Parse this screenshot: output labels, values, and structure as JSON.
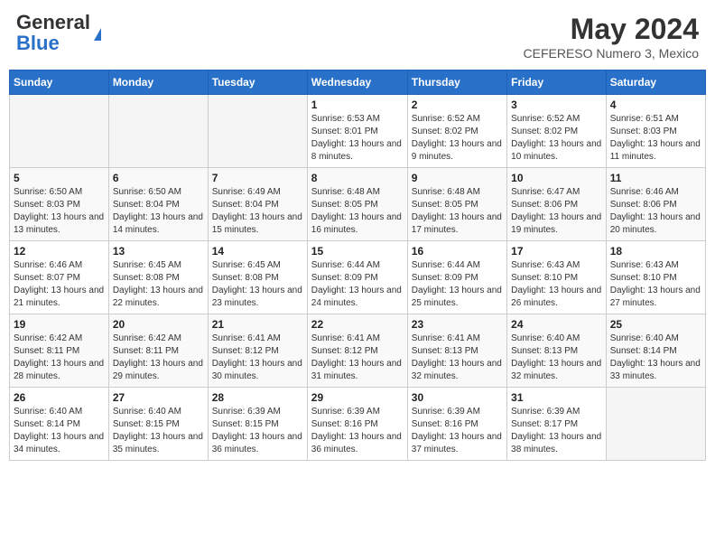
{
  "header": {
    "logo_general": "General",
    "logo_blue": "Blue",
    "title": "May 2024",
    "subtitle": "CEFERESO Numero 3, Mexico"
  },
  "days_of_week": [
    "Sunday",
    "Monday",
    "Tuesday",
    "Wednesday",
    "Thursday",
    "Friday",
    "Saturday"
  ],
  "weeks": [
    [
      {
        "day": "",
        "info": ""
      },
      {
        "day": "",
        "info": ""
      },
      {
        "day": "",
        "info": ""
      },
      {
        "day": "1",
        "info": "Sunrise: 6:53 AM\nSunset: 8:01 PM\nDaylight: 13 hours and 8 minutes."
      },
      {
        "day": "2",
        "info": "Sunrise: 6:52 AM\nSunset: 8:02 PM\nDaylight: 13 hours and 9 minutes."
      },
      {
        "day": "3",
        "info": "Sunrise: 6:52 AM\nSunset: 8:02 PM\nDaylight: 13 hours and 10 minutes."
      },
      {
        "day": "4",
        "info": "Sunrise: 6:51 AM\nSunset: 8:03 PM\nDaylight: 13 hours and 11 minutes."
      }
    ],
    [
      {
        "day": "5",
        "info": "Sunrise: 6:50 AM\nSunset: 8:03 PM\nDaylight: 13 hours and 13 minutes."
      },
      {
        "day": "6",
        "info": "Sunrise: 6:50 AM\nSunset: 8:04 PM\nDaylight: 13 hours and 14 minutes."
      },
      {
        "day": "7",
        "info": "Sunrise: 6:49 AM\nSunset: 8:04 PM\nDaylight: 13 hours and 15 minutes."
      },
      {
        "day": "8",
        "info": "Sunrise: 6:48 AM\nSunset: 8:05 PM\nDaylight: 13 hours and 16 minutes."
      },
      {
        "day": "9",
        "info": "Sunrise: 6:48 AM\nSunset: 8:05 PM\nDaylight: 13 hours and 17 minutes."
      },
      {
        "day": "10",
        "info": "Sunrise: 6:47 AM\nSunset: 8:06 PM\nDaylight: 13 hours and 19 minutes."
      },
      {
        "day": "11",
        "info": "Sunrise: 6:46 AM\nSunset: 8:06 PM\nDaylight: 13 hours and 20 minutes."
      }
    ],
    [
      {
        "day": "12",
        "info": "Sunrise: 6:46 AM\nSunset: 8:07 PM\nDaylight: 13 hours and 21 minutes."
      },
      {
        "day": "13",
        "info": "Sunrise: 6:45 AM\nSunset: 8:08 PM\nDaylight: 13 hours and 22 minutes."
      },
      {
        "day": "14",
        "info": "Sunrise: 6:45 AM\nSunset: 8:08 PM\nDaylight: 13 hours and 23 minutes."
      },
      {
        "day": "15",
        "info": "Sunrise: 6:44 AM\nSunset: 8:09 PM\nDaylight: 13 hours and 24 minutes."
      },
      {
        "day": "16",
        "info": "Sunrise: 6:44 AM\nSunset: 8:09 PM\nDaylight: 13 hours and 25 minutes."
      },
      {
        "day": "17",
        "info": "Sunrise: 6:43 AM\nSunset: 8:10 PM\nDaylight: 13 hours and 26 minutes."
      },
      {
        "day": "18",
        "info": "Sunrise: 6:43 AM\nSunset: 8:10 PM\nDaylight: 13 hours and 27 minutes."
      }
    ],
    [
      {
        "day": "19",
        "info": "Sunrise: 6:42 AM\nSunset: 8:11 PM\nDaylight: 13 hours and 28 minutes."
      },
      {
        "day": "20",
        "info": "Sunrise: 6:42 AM\nSunset: 8:11 PM\nDaylight: 13 hours and 29 minutes."
      },
      {
        "day": "21",
        "info": "Sunrise: 6:41 AM\nSunset: 8:12 PM\nDaylight: 13 hours and 30 minutes."
      },
      {
        "day": "22",
        "info": "Sunrise: 6:41 AM\nSunset: 8:12 PM\nDaylight: 13 hours and 31 minutes."
      },
      {
        "day": "23",
        "info": "Sunrise: 6:41 AM\nSunset: 8:13 PM\nDaylight: 13 hours and 32 minutes."
      },
      {
        "day": "24",
        "info": "Sunrise: 6:40 AM\nSunset: 8:13 PM\nDaylight: 13 hours and 32 minutes."
      },
      {
        "day": "25",
        "info": "Sunrise: 6:40 AM\nSunset: 8:14 PM\nDaylight: 13 hours and 33 minutes."
      }
    ],
    [
      {
        "day": "26",
        "info": "Sunrise: 6:40 AM\nSunset: 8:14 PM\nDaylight: 13 hours and 34 minutes."
      },
      {
        "day": "27",
        "info": "Sunrise: 6:40 AM\nSunset: 8:15 PM\nDaylight: 13 hours and 35 minutes."
      },
      {
        "day": "28",
        "info": "Sunrise: 6:39 AM\nSunset: 8:15 PM\nDaylight: 13 hours and 36 minutes."
      },
      {
        "day": "29",
        "info": "Sunrise: 6:39 AM\nSunset: 8:16 PM\nDaylight: 13 hours and 36 minutes."
      },
      {
        "day": "30",
        "info": "Sunrise: 6:39 AM\nSunset: 8:16 PM\nDaylight: 13 hours and 37 minutes."
      },
      {
        "day": "31",
        "info": "Sunrise: 6:39 AM\nSunset: 8:17 PM\nDaylight: 13 hours and 38 minutes."
      },
      {
        "day": "",
        "info": ""
      }
    ]
  ]
}
